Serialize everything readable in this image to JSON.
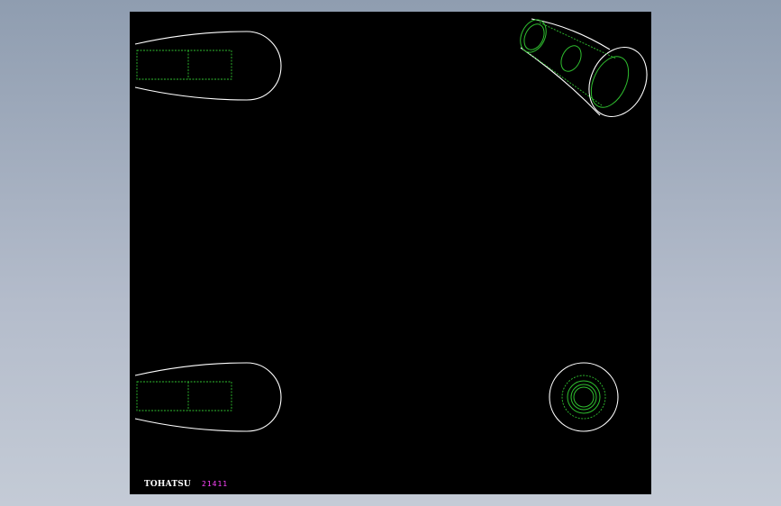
{
  "drawing": {
    "views": [
      {
        "name": "top-left-side-view",
        "label": ""
      },
      {
        "name": "top-right-isometric-view",
        "label": ""
      },
      {
        "name": "bottom-left-side-view",
        "label": ""
      },
      {
        "name": "bottom-right-end-view",
        "label": ""
      }
    ],
    "colors": {
      "background": "#000000",
      "outline": "#ffffff",
      "hidden_lines": "#2fbf2f",
      "code_text": "#ff44ff"
    }
  },
  "title_block": {
    "brand": "TOHATSU",
    "code": "21411"
  }
}
